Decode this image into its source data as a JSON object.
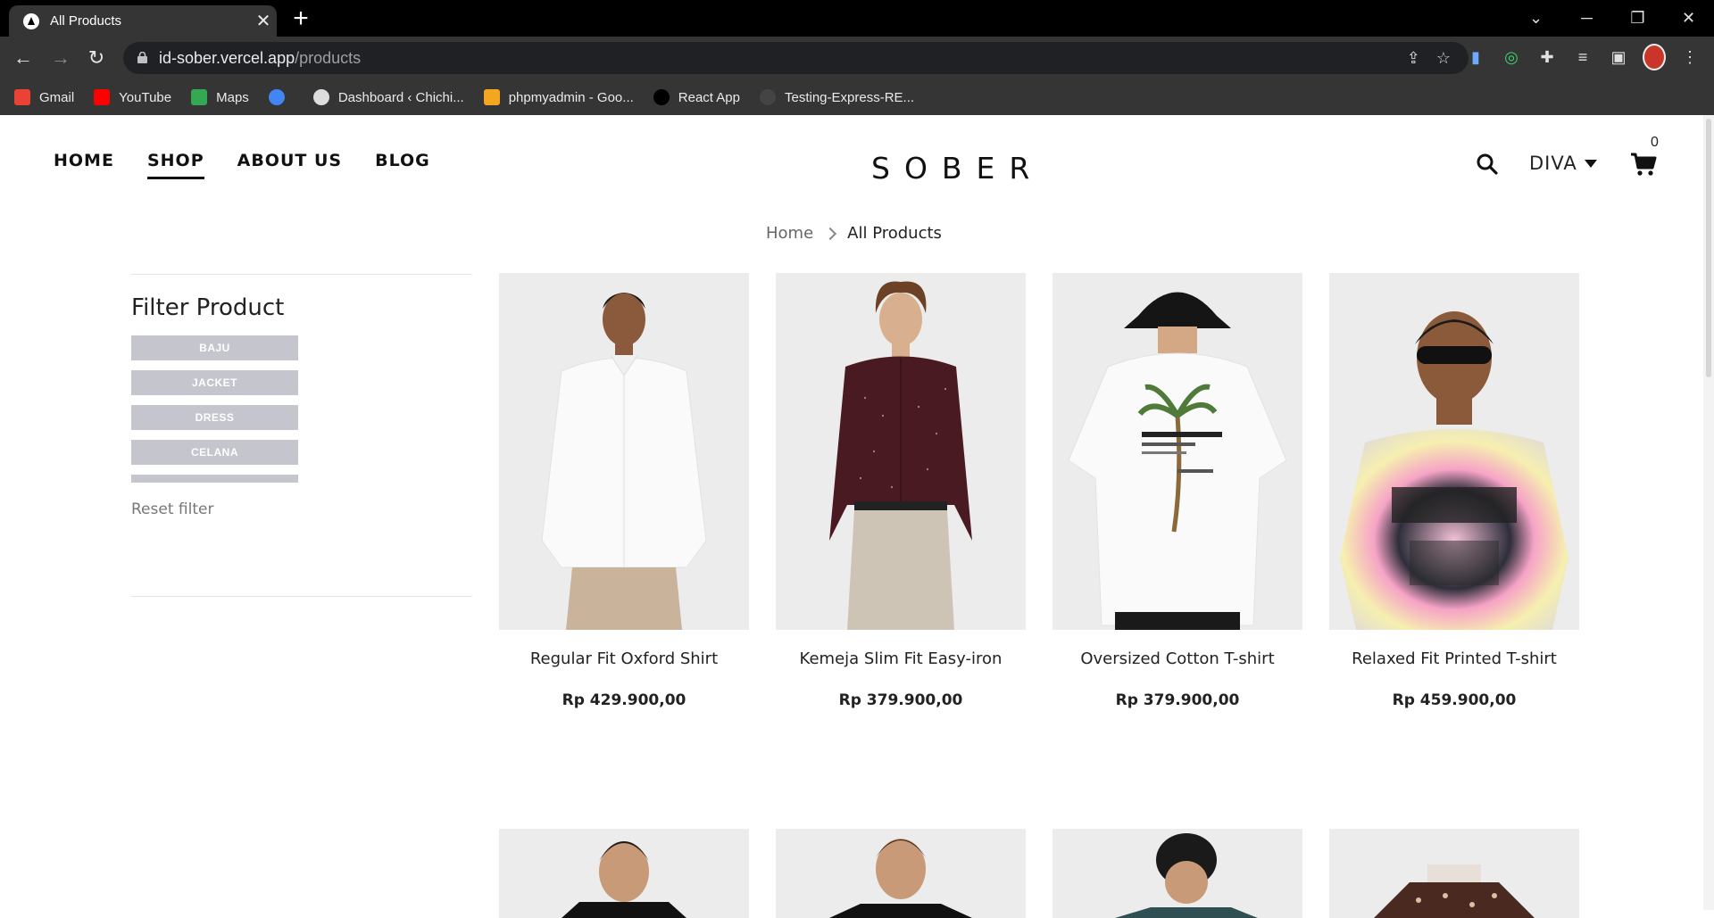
{
  "browser": {
    "tab_title": "All Products",
    "tab_close": "✕",
    "new_tab": "+",
    "url_host": "id-sober.vercel.app",
    "url_path": "/products",
    "bookmarks": [
      {
        "label": "Gmail",
        "color": "#ea4335"
      },
      {
        "label": "YouTube",
        "color": "#ff0000"
      },
      {
        "label": "Maps",
        "color": "#34a853"
      },
      {
        "label": "",
        "color": "#4285f4"
      },
      {
        "label": "Dashboard ‹ Chichi...",
        "color": "#dddddd"
      },
      {
        "label": "phpmyadmin - Goo...",
        "color": "#f4a522"
      },
      {
        "label": "React App",
        "color": "#000000"
      },
      {
        "label": "Testing-Express-RE...",
        "color": "#444444"
      }
    ]
  },
  "header": {
    "nav": [
      "HOME",
      "SHOP",
      "ABOUT US",
      "BLOG"
    ],
    "active_nav": "SHOP",
    "logo": "SOBER",
    "user": "DIVA",
    "cart_count": "0"
  },
  "breadcrumb": {
    "home": "Home",
    "current": "All Products"
  },
  "filter": {
    "title": "Filter Product",
    "categories": [
      "BAJU",
      "JACKET",
      "DRESS",
      "CELANA"
    ],
    "reset": "Reset filter"
  },
  "products": [
    {
      "name": "Regular Fit Oxford Shirt",
      "price": "Rp 429.900,00"
    },
    {
      "name": "Kemeja Slim Fit Easy-iron",
      "price": "Rp 379.900,00"
    },
    {
      "name": "Oversized Cotton T-shirt",
      "price": "Rp 379.900,00"
    },
    {
      "name": "Relaxed Fit Printed T-shirt",
      "price": "Rp 459.900,00"
    }
  ]
}
